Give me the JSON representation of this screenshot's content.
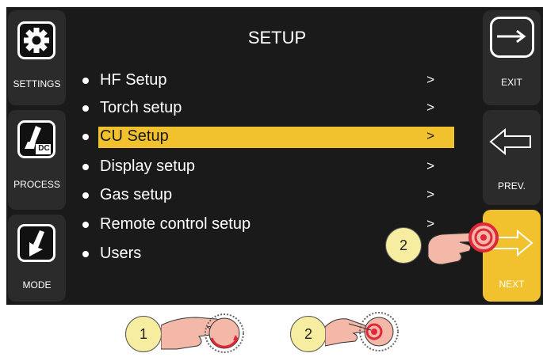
{
  "screen_title": "SETUP",
  "left_buttons": [
    {
      "label": "SETTINGS",
      "icon": "gear-icon"
    },
    {
      "label": "PROCESS",
      "icon": "dc-torch-icon",
      "icon_text": "DC"
    },
    {
      "label": "MODE",
      "icon": "mode-arrow-icon"
    }
  ],
  "right_buttons": [
    {
      "label": "EXIT",
      "icon": "exit-arrow-icon"
    },
    {
      "label": "PREV.",
      "icon": "left-arrow-icon"
    },
    {
      "label": "NEXT",
      "icon": "right-arrow-icon"
    }
  ],
  "menu": [
    {
      "label": "HF Setup",
      "chevron": ">"
    },
    {
      "label": "Torch setup",
      "chevron": ">"
    },
    {
      "label": "CU Setup",
      "chevron": ">",
      "selected": true
    },
    {
      "label": "Display setup",
      "chevron": ">"
    },
    {
      "label": "Gas setup",
      "chevron": ">"
    },
    {
      "label": "Remote control setup",
      "chevron": ">"
    },
    {
      "label": "Users",
      "chevron": ""
    }
  ],
  "steps": {
    "on_screen": "2",
    "knob_turn": "1",
    "knob_press": "2"
  },
  "colors": {
    "accent": "#f2c12e",
    "screen": "#1a1a1a",
    "button": "#2b2b2b",
    "badge": "#f7eda0",
    "press_ring": "#e0283a"
  }
}
